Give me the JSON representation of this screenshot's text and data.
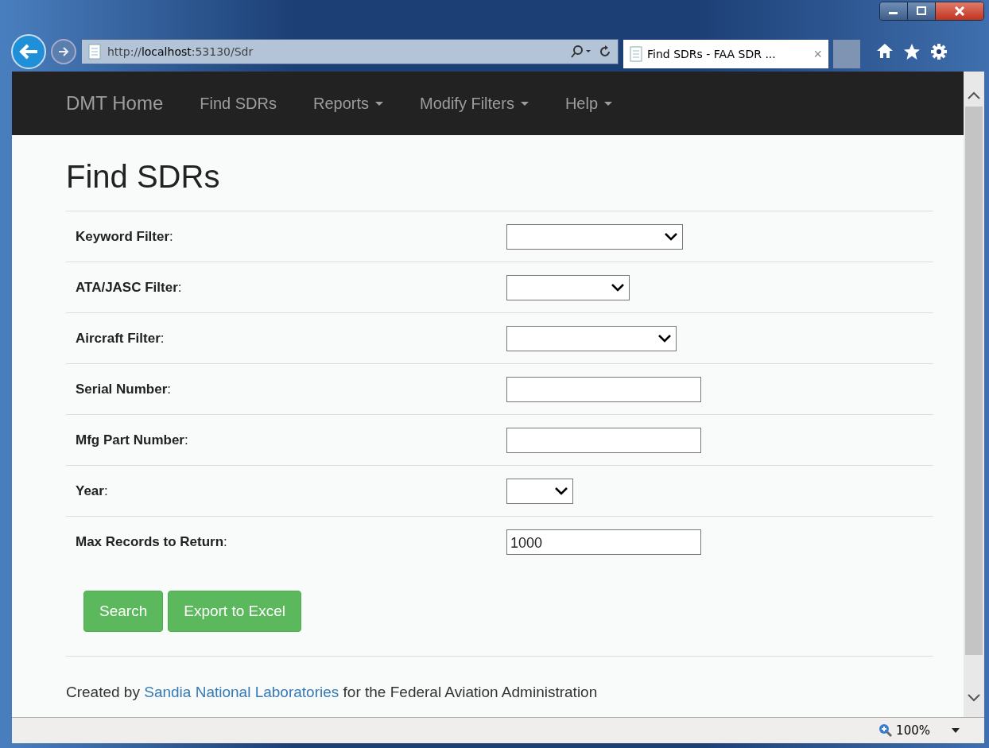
{
  "browser": {
    "address": "http://**localhost**:53130/Sdr",
    "tab": {
      "title": "Find SDRs - FAA SDR ...",
      "close": "×"
    }
  },
  "navbar": {
    "brand": "DMT Home",
    "items": [
      {
        "label": "Find SDRs",
        "dropdown": false
      },
      {
        "label": "Reports",
        "dropdown": true
      },
      {
        "label": "Modify Filters",
        "dropdown": true
      },
      {
        "label": "Help",
        "dropdown": true
      }
    ]
  },
  "page": {
    "title": "Find SDRs",
    "fields": [
      {
        "label": "**Keyword Filter**:",
        "kind": "select"
      },
      {
        "label": "**ATA/JASC Filter**:",
        "kind": "select"
      },
      {
        "label": "**Aircraft Filter**:",
        "kind": "select"
      },
      {
        "label": "**Serial Number**:",
        "kind": "text"
      },
      {
        "label": "**Mfg Part Number**:",
        "kind": "text"
      },
      {
        "label": "**Year**:",
        "kind": "select"
      },
      {
        "label": "**Max Records to Return**:",
        "kind": "text",
        "value": "1000"
      }
    ],
    "buttons": [
      "Search",
      "Export to Excel"
    ],
    "footer": {
      "before": "Created by",
      "link": "Sandia National Laboratories",
      "after": "for the Federal Aviation Administration"
    }
  },
  "status_bar": {
    "zoom": "100%"
  }
}
